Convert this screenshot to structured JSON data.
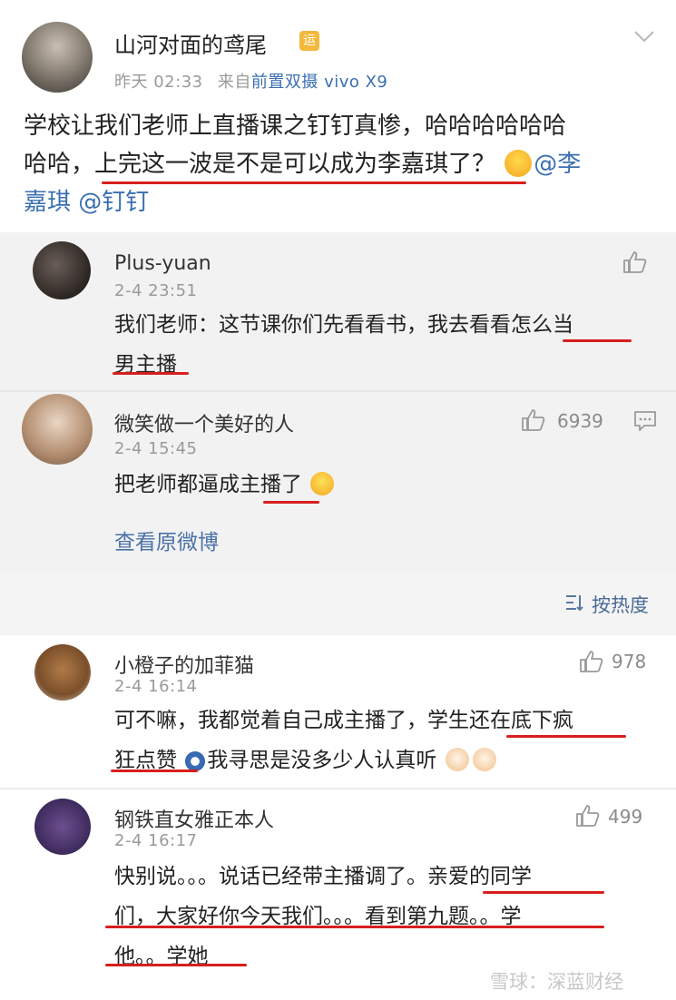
{
  "post": {
    "username": "山河对面的鸢尾",
    "badge": "运",
    "time": "昨天 02:33",
    "source_prefix": "来自",
    "source_device": "前置双摄 vivo X9",
    "text_line1": "学校让我们老师上直播课之钉钉真惨，哈哈哈哈哈哈",
    "text_line2_a": "哈哈，",
    "text_line2_b": "上完这一波是不是可以成为李嘉琪了？",
    "mention1_a": "@李",
    "mention1_b": "嘉琪",
    "mention2": "@钉钉"
  },
  "reply_box": {
    "reply1": {
      "name": "Plus-yuan",
      "time": "2-4 23:51",
      "line1": "我们老师：这节课你们先看看书，我去看看怎么当",
      "line2": "男主播"
    },
    "reply2": {
      "name": "微笑做一个美好的人",
      "time": "2-4 15:45",
      "likes": "6939",
      "text_a": "把老师都逼成",
      "text_b": "主播",
      "text_c": "了",
      "view_original": "查看原微博"
    }
  },
  "sort": {
    "label": "按热度"
  },
  "comments": [
    {
      "name": "小橙子的加菲猫",
      "time": "2-4 16:14",
      "likes": "978",
      "line1": "可不嘛，我都觉着自己成主播了，学生还在底下疯",
      "line2_a": "狂点赞",
      "line2_b": "我寻思是没多少人认真听"
    },
    {
      "name": "钢铁直女雅正本人",
      "time": "2-4 16:17",
      "likes": "499",
      "line1": "快别说。。。说话已经带主播调了。亲爱的同学",
      "line2": "们，大家好你今天我们。。。看到第九题。。学",
      "line3": "他。。学她"
    }
  ],
  "watermark": "雪球：深蓝财经"
}
